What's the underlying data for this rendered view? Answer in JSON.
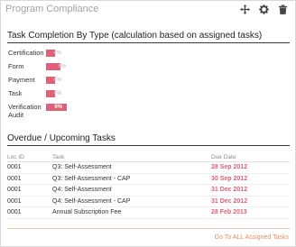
{
  "header": {
    "title": "Program Compliance",
    "icons": [
      "move-icon",
      "gear-icon",
      "trash-icon"
    ]
  },
  "task_completion": {
    "heading": "Task Completion By Type (calculation based on assigned tasks)",
    "rows": [
      {
        "label": "Certification",
        "percent": 4,
        "percent_label": "4%"
      },
      {
        "label": "Form",
        "percent": 6,
        "percent_label": "6%"
      },
      {
        "label": "Payment",
        "percent": 4,
        "percent_label": "4%"
      },
      {
        "label": "Task",
        "percent": 4,
        "percent_label": "4%"
      },
      {
        "label": "Verification Audit",
        "percent": 9,
        "percent_label": "9%"
      }
    ]
  },
  "tasks": {
    "heading": "Overdue / Upcoming Tasks",
    "columns": [
      "Loc ID",
      "Task",
      "Due Date"
    ],
    "rows": [
      {
        "loc": "0001",
        "task": "Q3: Self-Assessment",
        "due": "28 Sep 2012"
      },
      {
        "loc": "0001",
        "task": "Q3: Self-Assessment - CAP",
        "due": "30 Sep 2012"
      },
      {
        "loc": "0001",
        "task": "Q4: Self-Assessment",
        "due": "31 Dec 2012"
      },
      {
        "loc": "0001",
        "task": "Q4: Self-Assessment - CAP",
        "due": "31 Dec 2012"
      },
      {
        "loc": "0001",
        "task": "Annual Subscription Fee",
        "due": "28 Feb 2013"
      }
    ]
  },
  "footer": {
    "link": "Go To ALL Assigned Tasks"
  },
  "colors": {
    "accent": "#e06078",
    "link": "#f08a5d",
    "title": "#a3a3a3"
  }
}
